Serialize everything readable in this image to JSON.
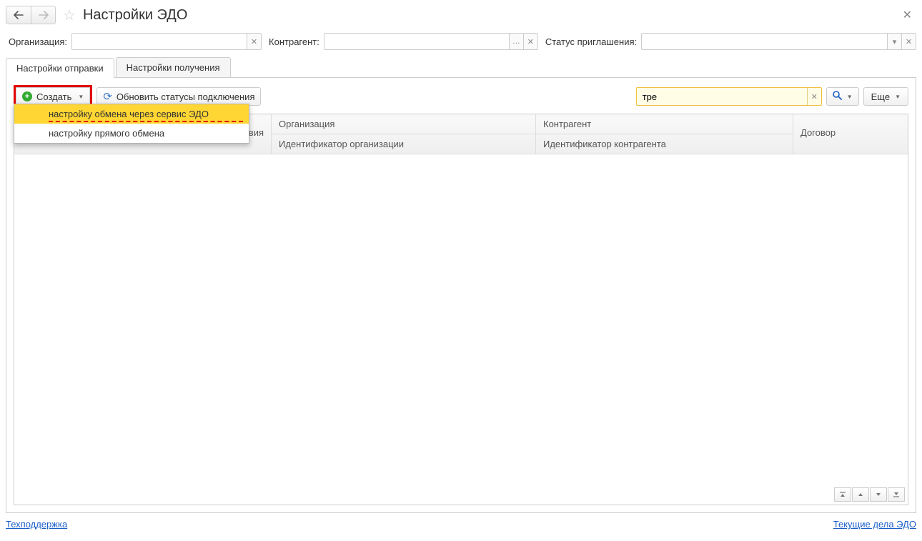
{
  "header": {
    "title": "Настройки ЭДО"
  },
  "filters": {
    "org_label": "Организация:",
    "org_value": "",
    "contr_label": "Контрагент:",
    "contr_value": "",
    "status_label": "Статус приглашения:",
    "status_value": ""
  },
  "tabs": [
    {
      "label": "Настройки отправки"
    },
    {
      "label": "Настройки получения"
    }
  ],
  "toolbar": {
    "create_label": "Создать",
    "refresh_label": "Обновить статусы подключения",
    "more_label": "Еще"
  },
  "search": {
    "value": "тре"
  },
  "create_menu": [
    {
      "label": "настройку обмена через сервис ЭДО",
      "highlighted": true
    },
    {
      "label": "настройку прямого обмена",
      "highlighted": false
    }
  ],
  "grid": {
    "col1": {
      "r1": "вия"
    },
    "col2": {
      "r1": "Организация",
      "r2": "Идентификатор организации"
    },
    "col3": {
      "r1": "Контрагент",
      "r2": "Идентификатор контрагента"
    },
    "col4": {
      "r1": "Договор"
    }
  },
  "footer": {
    "left": "Техподдержка",
    "right": "Текущие дела ЭДО"
  }
}
